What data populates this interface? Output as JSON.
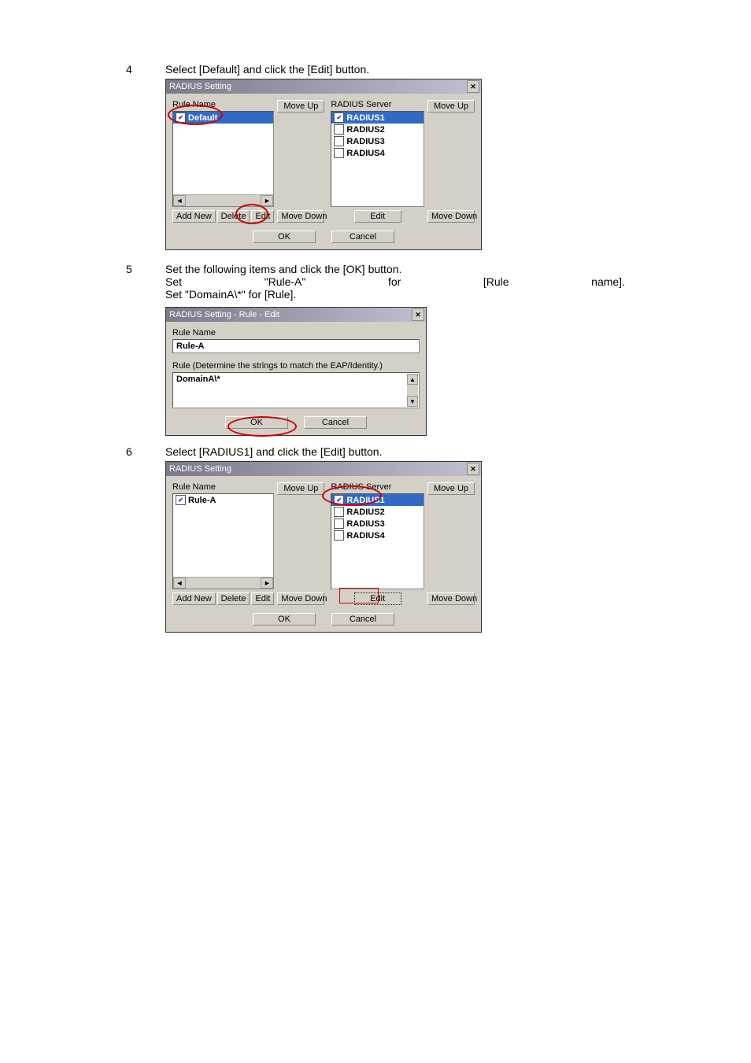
{
  "steps": {
    "s4": {
      "num": "4",
      "text": "Select [Default] and click the [Edit] button."
    },
    "s5": {
      "num": "5",
      "intro": "Set the following items and click the [OK] button.",
      "line2": {
        "a": "Set",
        "b": "\"Rule-A\"",
        "c": "for",
        "d": "[Rule",
        "e": "name]."
      },
      "line3": "Set \"DomainA\\*\" for [Rule]."
    },
    "s6": {
      "num": "6",
      "text": "Select [RADIUS1] and click the [Edit] button."
    }
  },
  "dlg1": {
    "title": "RADIUS Setting",
    "rule_hdr": "Rule Name",
    "server_hdr": "RADIUS Server",
    "rules": [
      {
        "label": "Default",
        "selected": true
      }
    ],
    "servers": [
      {
        "label": "RADIUS1",
        "selected": true
      },
      {
        "label": "RADIUS2",
        "selected": false
      },
      {
        "label": "RADIUS3",
        "selected": false
      },
      {
        "label": "RADIUS4",
        "selected": false
      }
    ],
    "move_up": "Move Up",
    "move_down": "Move Down",
    "add_new": "Add New",
    "delete": "Delete",
    "edit": "Edit",
    "ok": "OK",
    "cancel": "Cancel"
  },
  "dlg2": {
    "title": "RADIUS Setting - Rule - Edit",
    "rule_name_lbl": "Rule Name",
    "rule_name_val": "Rule-A",
    "rule_desc": "Rule (Determine the strings to match the EAP/Identity.)",
    "rule_val": "DomainA\\*",
    "ok": "OK",
    "cancel": "Cancel"
  },
  "dlg3": {
    "title": "RADIUS Setting",
    "rule_hdr": "Rule Name",
    "server_hdr": "RADIUS Server",
    "rules": [
      {
        "label": "Rule-A",
        "selected": false
      }
    ],
    "servers": [
      {
        "label": "RADIUS1",
        "selected": true
      },
      {
        "label": "RADIUS2",
        "selected": false
      },
      {
        "label": "RADIUS3",
        "selected": false
      },
      {
        "label": "RADIUS4",
        "selected": false
      }
    ],
    "move_up": "Move Up",
    "move_down": "Move Down",
    "add_new": "Add New",
    "delete": "Delete",
    "edit": "Edit",
    "ok": "OK",
    "cancel": "Cancel"
  }
}
